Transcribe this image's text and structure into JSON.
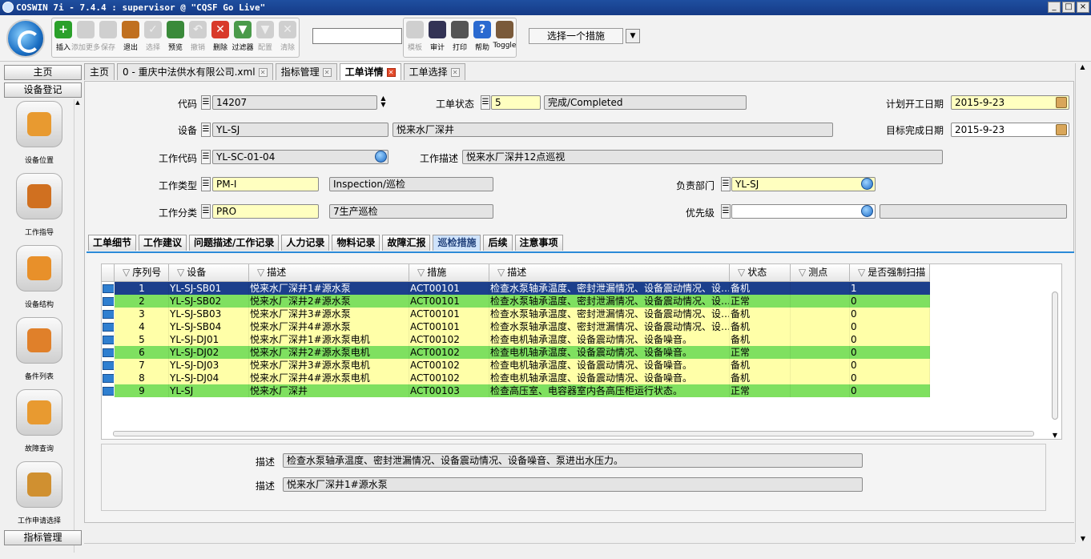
{
  "window": {
    "title": "COSWIN 7i - 7.4.4 : supervisor @ \"CQSF Go Live\"",
    "buttons": [
      "_",
      "□",
      "×"
    ]
  },
  "toolbar": {
    "buttons": [
      {
        "label": "插入",
        "icon": "plus-icon",
        "enabled": true,
        "color": "#2aa02a"
      },
      {
        "label": "添加更多",
        "icon": "add-more-icon",
        "enabled": false,
        "color": "#c0c0c0"
      },
      {
        "label": "保存",
        "icon": "save-icon",
        "enabled": false,
        "color": "#c0c0c0"
      },
      {
        "label": "退出",
        "icon": "exit-icon",
        "enabled": true,
        "color": "#c07020"
      },
      {
        "label": "选择",
        "icon": "check-icon",
        "enabled": false,
        "color": "#c0c0c0"
      },
      {
        "label": "预览",
        "icon": "preview-icon",
        "enabled": true,
        "color": "#3a8a3a"
      },
      {
        "label": "撤销",
        "icon": "undo-icon",
        "enabled": false,
        "color": "#c0c0c0"
      },
      {
        "label": "删除",
        "icon": "delete-icon",
        "enabled": true,
        "color": "#d83a2a"
      },
      {
        "label": "过滤器",
        "icon": "filter-add-icon",
        "enabled": true,
        "color": "#4a9a4a"
      },
      {
        "label": "配置",
        "icon": "configure-icon",
        "enabled": false,
        "color": "#c0c0c0"
      },
      {
        "label": "清除",
        "icon": "clear-icon",
        "enabled": false,
        "color": "#c0c0c0"
      }
    ],
    "buttons2": [
      {
        "label": "模板",
        "icon": "template-icon",
        "enabled": false,
        "color": "#c0c0c0"
      },
      {
        "label": "审计",
        "icon": "audit-icon",
        "enabled": true,
        "color": "#333355"
      },
      {
        "label": "打印",
        "icon": "print-icon",
        "enabled": true,
        "color": "#555555"
      },
      {
        "label": "帮助",
        "icon": "help-icon",
        "enabled": true,
        "color": "#2a6ad0"
      },
      {
        "label": "Toggle",
        "icon": "toggle-icon",
        "enabled": true,
        "color": "#7a5a3a"
      }
    ],
    "measure_select": "选择一个措施"
  },
  "nav": {
    "home": "主页",
    "equipment_register": "设备登记",
    "bottom": "指标管理",
    "items": [
      {
        "label": "设备位置",
        "icon": "equipment-location-icon",
        "color": "#e89a30"
      },
      {
        "label": "工作指导",
        "icon": "work-guide-icon",
        "color": "#d07020"
      },
      {
        "label": "设备结构",
        "icon": "equipment-structure-icon",
        "color": "#e8902a"
      },
      {
        "label": "备件列表",
        "icon": "spare-parts-icon",
        "color": "#e0802a"
      },
      {
        "label": "故障查询",
        "icon": "fault-query-icon",
        "color": "#e89a30"
      },
      {
        "label": "工作申请选择",
        "icon": "work-request-icon",
        "color": "#d09030"
      }
    ]
  },
  "tabs": [
    {
      "label": "主页",
      "closable": false,
      "active": false
    },
    {
      "label": "0 - 重庆中法供水有限公司.xml",
      "closable": true,
      "active": false
    },
    {
      "label": "指标管理",
      "closable": true,
      "active": false
    },
    {
      "label": "工单详情",
      "closable": true,
      "active": true
    },
    {
      "label": "工单选择",
      "closable": true,
      "active": false
    }
  ],
  "form": {
    "code_label": "代码",
    "code": "14207",
    "status_label": "工单状态",
    "status_code": "5",
    "status_desc": "完成/Completed",
    "plan_start_label": "计划开工日期",
    "plan_start": "2015-9-23",
    "equipment_label": "设备",
    "equipment": "YL-SJ",
    "equipment_desc": "悦来水厂深井",
    "target_finish_label": "目标完成日期",
    "target_finish": "2015-9-23",
    "work_code_label": "工作代码",
    "work_code": "YL-SC-01-04",
    "work_desc_label": "工作描述",
    "work_desc": "悦来水厂深井12点巡视",
    "work_type_label": "工作类型",
    "work_type": "PM-I",
    "work_type_desc": "Inspection/巡检",
    "dept_label": "负责部门",
    "dept": "YL-SJ",
    "work_class_label": "工作分类",
    "work_class": "PRO",
    "work_class_desc": "7生产巡检",
    "priority_label": "优先级",
    "priority": "",
    "priority_desc": ""
  },
  "subtabs": [
    {
      "label": "工单细节",
      "active": false
    },
    {
      "label": "工作建议",
      "active": false
    },
    {
      "label": "问题描述/工作记录",
      "active": false
    },
    {
      "label": "人力记录",
      "active": false
    },
    {
      "label": "物料记录",
      "active": false
    },
    {
      "label": "故障汇报",
      "active": false
    },
    {
      "label": "巡检措施",
      "active": true
    },
    {
      "label": "后续",
      "active": false
    },
    {
      "label": "注意事项",
      "active": false
    }
  ],
  "grid": {
    "columns": [
      "序列号",
      "设备",
      "描述",
      "措施",
      "描述",
      "状态",
      "测点",
      "是否强制扫描"
    ],
    "rows": [
      {
        "seq": "1",
        "equip": "YL-SJ-SB01",
        "desc": "悦来水厂深井1#源水泵",
        "measure": "ACT00101",
        "mdesc": "检查水泵轴承温度、密封泄漏情况、设备震动情况、设…",
        "status": "备机",
        "point": "",
        "forced": "1",
        "style": "selected"
      },
      {
        "seq": "2",
        "equip": "YL-SJ-SB02",
        "desc": "悦来水厂深井2#源水泵",
        "measure": "ACT00101",
        "mdesc": "检查水泵轴承温度、密封泄漏情况、设备震动情况、设…",
        "status": "正常",
        "point": "",
        "forced": "0",
        "style": "green"
      },
      {
        "seq": "3",
        "equip": "YL-SJ-SB03",
        "desc": "悦来水厂深井3#源水泵",
        "measure": "ACT00101",
        "mdesc": "检查水泵轴承温度、密封泄漏情况、设备震动情况、设…",
        "status": "备机",
        "point": "",
        "forced": "0",
        "style": "yellow"
      },
      {
        "seq": "4",
        "equip": "YL-SJ-SB04",
        "desc": "悦来水厂深井4#源水泵",
        "measure": "ACT00101",
        "mdesc": "检查水泵轴承温度、密封泄漏情况、设备震动情况、设…",
        "status": "备机",
        "point": "",
        "forced": "0",
        "style": "yellow"
      },
      {
        "seq": "5",
        "equip": "YL-SJ-DJ01",
        "desc": "悦来水厂深井1#源水泵电机",
        "measure": "ACT00102",
        "mdesc": "检查电机轴承温度、设备震动情况、设备噪音。",
        "status": "备机",
        "point": "",
        "forced": "0",
        "style": "yellow"
      },
      {
        "seq": "6",
        "equip": "YL-SJ-DJ02",
        "desc": "悦来水厂深井2#源水泵电机",
        "measure": "ACT00102",
        "mdesc": "检查电机轴承温度、设备震动情况、设备噪音。",
        "status": "正常",
        "point": "",
        "forced": "0",
        "style": "green"
      },
      {
        "seq": "7",
        "equip": "YL-SJ-DJ03",
        "desc": "悦来水厂深井3#源水泵电机",
        "measure": "ACT00102",
        "mdesc": "检查电机轴承温度、设备震动情况、设备噪音。",
        "status": "备机",
        "point": "",
        "forced": "0",
        "style": "yellow"
      },
      {
        "seq": "8",
        "equip": "YL-SJ-DJ04",
        "desc": "悦来水厂深井4#源水泵电机",
        "measure": "ACT00102",
        "mdesc": "检查电机轴承温度、设备震动情况、设备噪音。",
        "status": "备机",
        "point": "",
        "forced": "0",
        "style": "yellow"
      },
      {
        "seq": "9",
        "equip": "YL-SJ",
        "desc": "悦来水厂深井",
        "measure": "ACT00103",
        "mdesc": "检查高压室、电容器室内各高压柜运行状态。",
        "status": "正常",
        "point": "",
        "forced": "0",
        "style": "green"
      }
    ]
  },
  "detail": {
    "desc1_label": "描述",
    "desc1": "检查水泵轴承温度、密封泄漏情况、设备震动情况、设备噪音、泵进出水压力。",
    "desc2_label": "描述",
    "desc2": "悦来水厂深井1#源水泵"
  }
}
